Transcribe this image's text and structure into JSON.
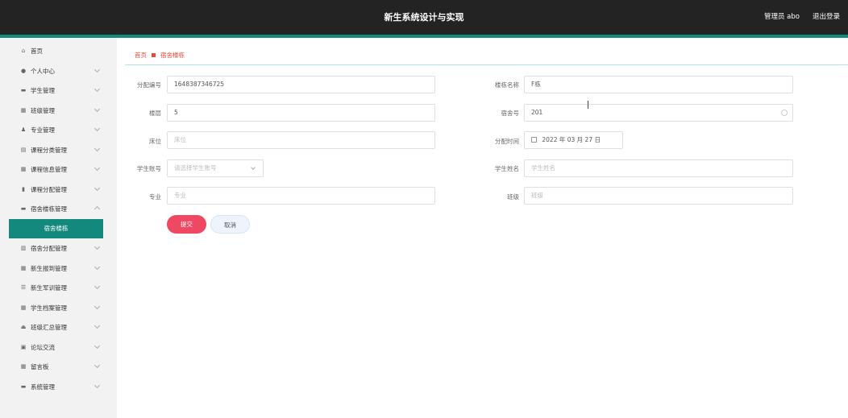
{
  "header": {
    "title": "新生系统设计与实现",
    "user": "管理员 abo",
    "logout": "退出登录"
  },
  "sidebar": {
    "items": [
      {
        "label": "首页",
        "icon": "⌂",
        "chevron": false
      },
      {
        "label": "个人中心",
        "icon": "●",
        "chevron": true
      },
      {
        "label": "学生管理",
        "icon": "▬",
        "chevron": true
      },
      {
        "label": "班级管理",
        "icon": "▦",
        "chevron": true
      },
      {
        "label": "专业管理",
        "icon": "♟",
        "chevron": true
      },
      {
        "label": "课程分类管理",
        "icon": "▤",
        "chevron": true
      },
      {
        "label": "课程信息管理",
        "icon": "▦",
        "chevron": true
      },
      {
        "label": "课程分配管理",
        "icon": "▮",
        "chevron": true
      },
      {
        "label": "宿舍楼栋管理",
        "icon": "▬",
        "chevron": true
      },
      {
        "label": "宿舍分配管理",
        "icon": "▥",
        "chevron": true
      },
      {
        "label": "新生报到管理",
        "icon": "▦",
        "chevron": true
      },
      {
        "label": "新生军训管理",
        "icon": "☰",
        "chevron": true
      },
      {
        "label": "学生档案管理",
        "icon": "▦",
        "chevron": true
      },
      {
        "label": "班级汇总管理",
        "icon": "⏏",
        "chevron": true
      },
      {
        "label": "论坛交流",
        "icon": "▣",
        "chevron": true
      },
      {
        "label": "留言板",
        "icon": "▦",
        "chevron": true
      },
      {
        "label": "系统管理",
        "icon": "▬",
        "chevron": true
      }
    ],
    "active_sub": "宿舍楼栋"
  },
  "breadcrumb": {
    "home": "首页",
    "current": "宿舍楼栋"
  },
  "form": {
    "alloc_no": {
      "label": "分配编号",
      "value": "1648387346725"
    },
    "building_name": {
      "label": "楼栋名称",
      "value": "F栋"
    },
    "floor": {
      "label": "楼层",
      "value": "5"
    },
    "room_no": {
      "label": "宿舍号",
      "value": "201"
    },
    "bed": {
      "label": "床位",
      "placeholder": "床位"
    },
    "alloc_time": {
      "label": "分配时间",
      "value": "2022 年 03 月 27 日"
    },
    "student_account": {
      "label": "学生账号",
      "placeholder": "请选择学生账号"
    },
    "student_name": {
      "label": "学生姓名",
      "placeholder": "学生姓名"
    },
    "major": {
      "label": "专业",
      "placeholder": "专业"
    },
    "class": {
      "label": "班级",
      "placeholder": "班级"
    }
  },
  "buttons": {
    "submit": "提交",
    "cancel": "取消"
  }
}
